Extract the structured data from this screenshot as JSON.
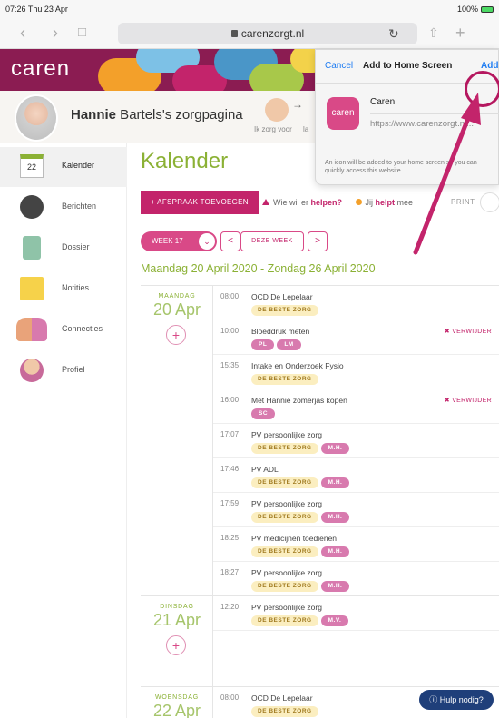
{
  "status": {
    "time": "07:26",
    "date": "Thu 23 Apr",
    "battery": "100%"
  },
  "browser": {
    "url": "carenzorgt.nl"
  },
  "header": {
    "logo": "caren"
  },
  "profile": {
    "first_name": "Hannie",
    "rest": " Bartels's zorgpagina",
    "carer_label": "Ik zorg voor",
    "carer_label_cut": "la"
  },
  "sidebar": {
    "calendar_day": "22",
    "items": [
      {
        "label": "Kalender",
        "active": true
      },
      {
        "label": "Berichten"
      },
      {
        "label": "Dossier"
      },
      {
        "label": "Notities"
      },
      {
        "label": "Connecties"
      },
      {
        "label": "Profiel"
      }
    ]
  },
  "main": {
    "title": "Kalender",
    "add_button": "+ AFSPRAAK TOEVOEGEN",
    "help_prefix": "Wie wil er ",
    "help_strong": "helpen?",
    "self_prefix": "Jij ",
    "self_strong": "helpt",
    "self_suffix": " mee",
    "print": "PRINT",
    "week_pill": "WEEK 17",
    "prev": "<",
    "this_week": "DEZE WEEK",
    "next": ">",
    "range": "Maandag 20 April 2020 - Zondag 26 April 2020"
  },
  "calendar": {
    "remove_label": "✖ VERWIJDER",
    "days": [
      {
        "name": "MAANDAG",
        "date": "20 Apr",
        "events": [
          {
            "time": "08:00",
            "title": "OCD De Lepelaar",
            "org": "DE BESTE ZORG",
            "persons": []
          },
          {
            "time": "10:00",
            "title": "Bloeddruk meten",
            "org": "",
            "persons": [
              "PL",
              "LM"
            ],
            "remove": true
          },
          {
            "time": "15:35",
            "title": "Intake en Onderzoek Fysio",
            "org": "DE BESTE ZORG",
            "persons": []
          },
          {
            "time": "16:00",
            "title": "Met Hannie zomerjas kopen",
            "org": "",
            "persons": [
              "SC"
            ],
            "remove": true
          },
          {
            "time": "17:07",
            "title": "PV persoonlijke zorg",
            "org": "DE BESTE ZORG",
            "persons": [
              "M.H."
            ]
          },
          {
            "time": "17:46",
            "title": "PV ADL",
            "org": "DE BESTE ZORG",
            "persons": [
              "M.H."
            ]
          },
          {
            "time": "17:59",
            "title": "PV persoonlijke zorg",
            "org": "DE BESTE ZORG",
            "persons": [
              "M.H."
            ]
          },
          {
            "time": "18:25",
            "title": "PV medicijnen toedienen",
            "org": "DE BESTE ZORG",
            "persons": [
              "M.H."
            ]
          },
          {
            "time": "18:27",
            "title": "PV persoonlijke zorg",
            "org": "DE BESTE ZORG",
            "persons": [
              "M.H."
            ]
          }
        ]
      },
      {
        "name": "DINSDAG",
        "date": "21 Apr",
        "events": [
          {
            "time": "12:20",
            "title": "PV persoonlijke zorg",
            "org": "DE BESTE ZORG",
            "persons": [
              "M.V."
            ]
          }
        ]
      },
      {
        "name": "WOENSDAG",
        "date": "22 Apr",
        "events": [
          {
            "time": "08:00",
            "title": "OCD De Lepelaar",
            "org": "DE BESTE ZORG",
            "persons": []
          }
        ]
      }
    ]
  },
  "help_fab": "Hulp nodig?",
  "popover": {
    "cancel": "Cancel",
    "title": "Add to Home Screen",
    "add": "Add",
    "app_icon_text": "caren",
    "app_name": "Caren",
    "url": "https://www.carenzorgt.nl...",
    "note": "An icon will be added to your home screen so you can quickly access this website."
  },
  "colors": {
    "brand": "#8b1c52",
    "accent": "#c3246b",
    "green": "#8bb135",
    "ios_blue": "#1e7cf2"
  }
}
